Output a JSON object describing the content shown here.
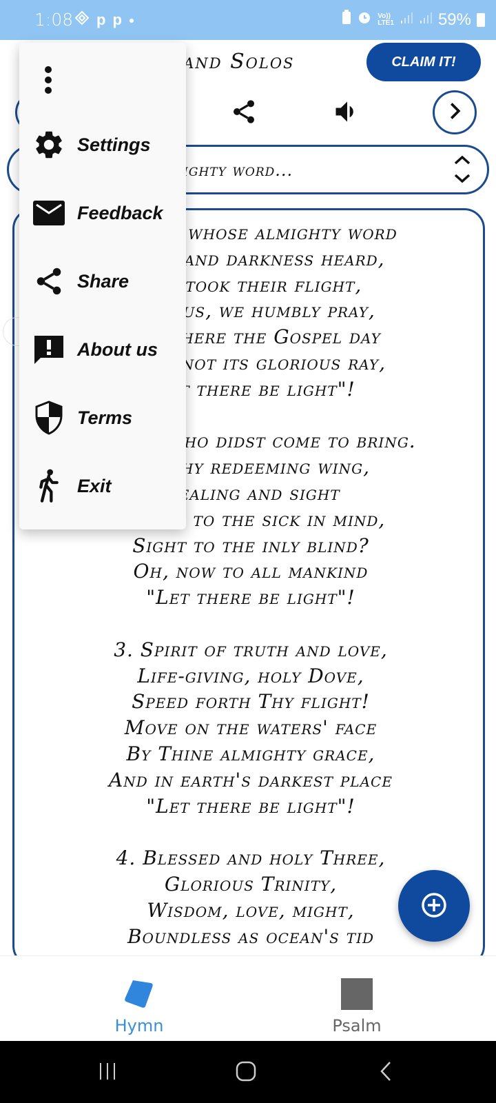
{
  "status_bar": {
    "time": "1:08",
    "left_icons": [
      "app-diamond-icon",
      "p-icon",
      "p-icon",
      "dot-icon"
    ],
    "network_label_top": "Vo))",
    "network_label_bottom": "LTE1",
    "battery": "59%"
  },
  "header": {
    "title": "Hymns, Songs and Solos",
    "claim_button": "CLAIM IT!"
  },
  "toolbar": {
    "icons": [
      "share-icon",
      "volume-icon",
      "chevron-right-icon"
    ]
  },
  "selector": {
    "value": "1. Thou whose almighty word..."
  },
  "lyrics": {
    "stanzas": [
      [
        "1. Thou whose almighty word",
        "Chaos and darkness heard,",
        "And took their flight,",
        "Hear us, we humbly pray,",
        "And where the Gospel day",
        "Sheds not its glorious ray,",
        "\"Let there be light\"!"
      ],
      [
        "2. Thou who didst come to bring.",
        "On Thy redeeming wing,",
        "Healing and sight",
        "Health to the sick in mind,",
        "Sight to the inly blind?",
        "Oh, now to all mankind",
        "\"Let there be light\"!"
      ],
      [
        "3. Spirit of truth and love,",
        "Life-giving, holy Dove,",
        "Speed forth Thy flight!",
        "Move on the waters' face",
        "By Thine almighty grace,",
        "And in earth's darkest place",
        "\"Let there be light\"!"
      ],
      [
        "4. Blessed and holy Three,",
        "Glorious Trinity,",
        "Wisdom, love, might,",
        "Boundless as ocean's tid"
      ]
    ]
  },
  "menu": {
    "items": [
      {
        "label": "Settings",
        "icon": "gear-icon"
      },
      {
        "label": "Feedback",
        "icon": "mail-icon"
      },
      {
        "label": "Share",
        "icon": "share-icon"
      },
      {
        "label": "About us",
        "icon": "feedback-exclamation-icon"
      },
      {
        "label": "Terms",
        "icon": "shield-icon"
      },
      {
        "label": "Exit",
        "icon": "walking-person-icon"
      }
    ]
  },
  "bottom_nav": {
    "items": [
      {
        "label": "Hymn",
        "active": true,
        "color": "#3b8fd9"
      },
      {
        "label": "Psalm",
        "active": false,
        "color": "#666666"
      }
    ]
  },
  "colors": {
    "status_bar": "#90c5f3",
    "brand_blue": "#0f4a9e",
    "border_blue": "#1b4b8f",
    "active_tab": "#3b8fd9"
  }
}
